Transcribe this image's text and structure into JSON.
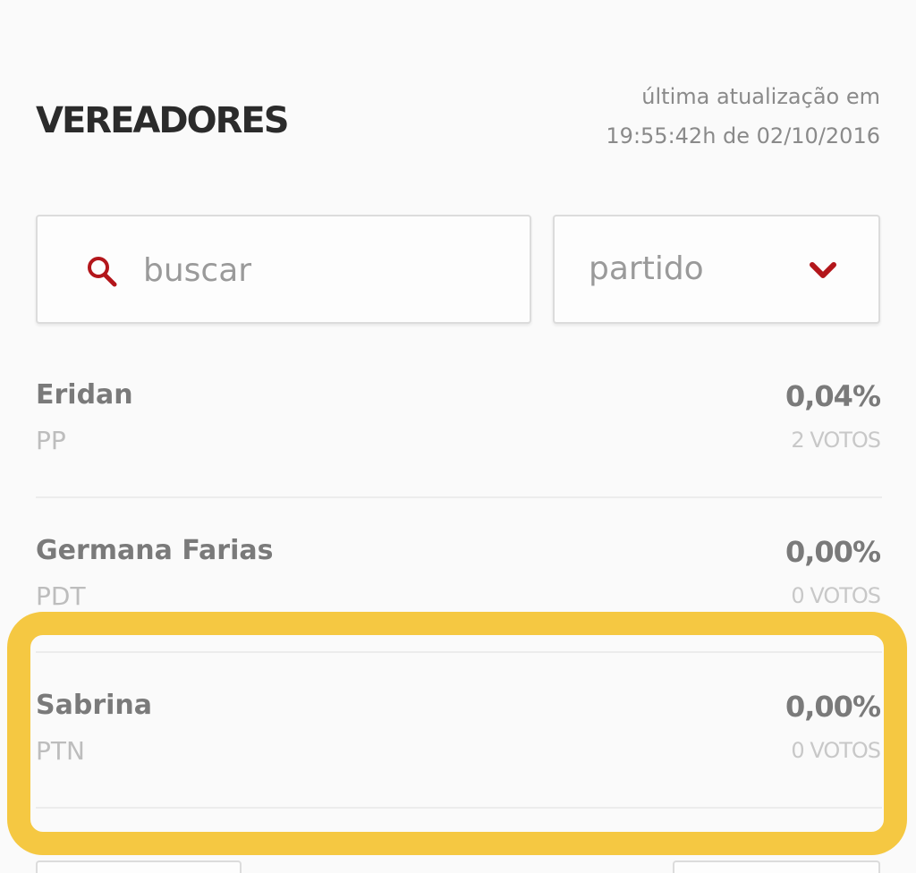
{
  "header": {
    "title": "VEREADORES",
    "update_line1": "última atualização em",
    "update_line2": "19:55:42h de 02/10/2016"
  },
  "search": {
    "placeholder": "buscar"
  },
  "party_filter": {
    "label": "partido"
  },
  "candidates": [
    {
      "name": "Eridan",
      "party": "PP",
      "percent": "0,04%",
      "votes": "2 VOTOS"
    },
    {
      "name": "Germana Farias",
      "party": "PDT",
      "percent": "0,00%",
      "votes": "0 VOTOS"
    },
    {
      "name": "Sabrina",
      "party": "PTN",
      "percent": "0,00%",
      "votes": "0 VOTOS"
    }
  ],
  "colors": {
    "accent_red": "#b3161b",
    "highlight_yellow": "#f5c842"
  }
}
